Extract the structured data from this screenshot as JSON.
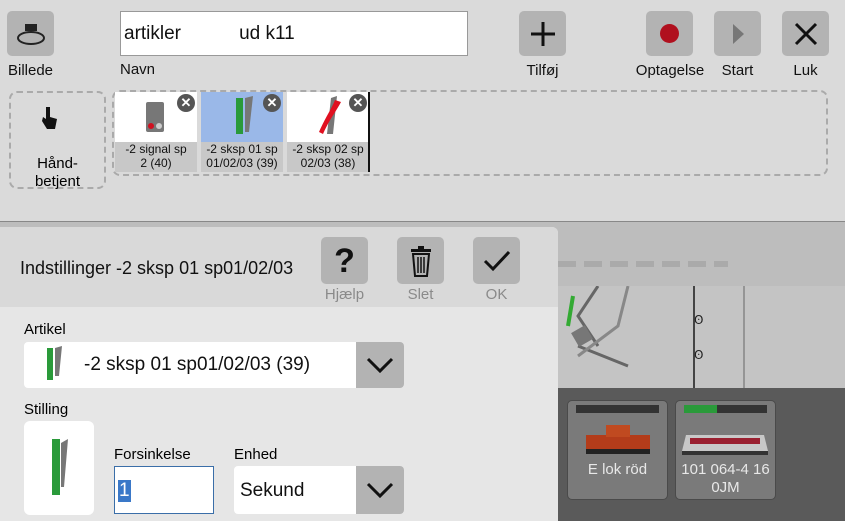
{
  "toolbar": {
    "picture_label": "Billede",
    "name_label": "Navn",
    "name_value": "artikler           ud k11",
    "add_label": "Tilføj",
    "record_label": "Optagelse",
    "start_label": "Start",
    "close_label": "Luk",
    "colors": {
      "record": "#b0101e",
      "button_bg": "#b3b3b3"
    }
  },
  "strip": {
    "manual_label_1": "Hånd-",
    "manual_label_2": "betjent",
    "items": [
      {
        "caption_1": "-2  signal  sp",
        "caption_2": "2 (40)",
        "icon": "signal-icon",
        "selected": false
      },
      {
        "caption_1": "-2 sksp 01 sp",
        "caption_2": "01/02/03 (39)",
        "icon": "switch-straight-icon",
        "selected": true
      },
      {
        "caption_1": "-2 sksp 02 sp",
        "caption_2": "02/03 (38)",
        "icon": "switch-curve-icon",
        "selected": false
      }
    ]
  },
  "settings": {
    "title": "Indstillinger -2 sksp 01 sp01/02/03",
    "help_label": "Hjælp",
    "delete_label": "Slet",
    "ok_label": "OK",
    "article_label": "Artikel",
    "article_value": "-2 sksp 01 sp01/02/03 (39)",
    "position_label": "Stilling",
    "delay_label": "Forsinkelse",
    "delay_value": "1",
    "unit_label": "Enhed",
    "unit_value": "Sekund"
  },
  "locos": [
    {
      "name_1": "E lok röd",
      "name_2": "",
      "speed": 0
    },
    {
      "name_1": "101 064-4 16",
      "name_2": "0JM",
      "speed": 0.4
    }
  ]
}
